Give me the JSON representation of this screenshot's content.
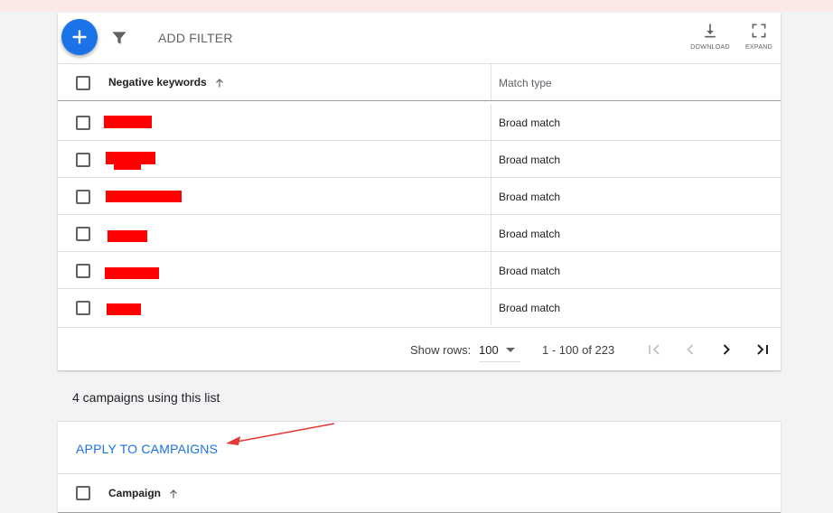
{
  "toolbar": {
    "add_filter_label": "ADD FILTER",
    "download_label": "DOWNLOAD",
    "expand_label": "EXPAND",
    "icons": [
      "add-icon",
      "filter-icon",
      "download-icon",
      "expand-icon"
    ]
  },
  "table": {
    "columns": [
      "Negative keywords",
      "Match type"
    ],
    "rows": [
      {
        "keyword": "",
        "match_type": "Broad match"
      },
      {
        "keyword": "",
        "match_type": "Broad match"
      },
      {
        "keyword": "",
        "match_type": "Broad match"
      },
      {
        "keyword": "",
        "match_type": "Broad match"
      },
      {
        "keyword": "",
        "match_type": "Broad match"
      },
      {
        "keyword": "",
        "match_type": "Broad match"
      }
    ]
  },
  "pagination": {
    "show_rows_label": "Show rows:",
    "rows_per_page": "100",
    "range": "1 - 100 of 223"
  },
  "campaigns": {
    "count_text": "4 campaigns using this list",
    "apply_label": "APPLY TO CAMPAIGNS",
    "column": "Campaign"
  },
  "colors": {
    "accent": "#1a73e8",
    "redaction": "#ff0000",
    "annotation_arrow": "#e53935"
  }
}
